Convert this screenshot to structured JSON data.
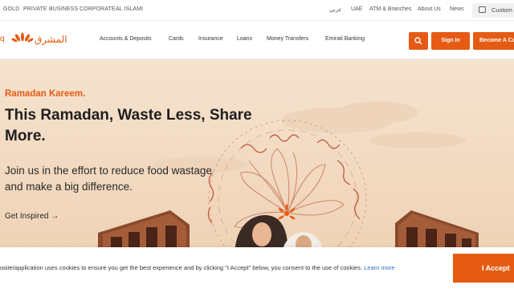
{
  "segments": [
    "GOLD",
    "PRIVATE",
    "BUSINESS",
    "CORPORATE",
    "AL ISLAMI"
  ],
  "utility_links": [
    "عربي",
    "UAE",
    "ATM & Branches",
    "About Us",
    "News"
  ],
  "customer_button": "Custom",
  "logo": {
    "arabic_text": "المشرق",
    "edge_glyph": "q"
  },
  "nav_items": [
    "Accounts & Deposits",
    "Cards",
    "Insurance",
    "Loans",
    "Money Transfers",
    "Emirati Banking"
  ],
  "buttons": {
    "sign_in": "Sign In",
    "become_customer": "Become A Cu"
  },
  "hero": {
    "eyebrow": "Ramadan Kareem.",
    "headline": "This Ramadan, Waste Less, Share More.",
    "subtext": "Join us in the effort to reduce food wastage and make a big difference.",
    "cta": "Get Inspired",
    "cta_arrow": "→"
  },
  "cookie": {
    "text": "osite/application uses cookies to ensure you get the best experience and by clicking \"I Accept\" below, you consent to the use of cookies.",
    "link": "Learn more",
    "accept": "I Accept"
  },
  "colors": {
    "accent": "#e55b13",
    "hero_bg": "#f5e3cf",
    "link": "#2a6ebb"
  },
  "icons": [
    "search-icon",
    "customer-service-icon",
    "logo-sunburst-icon",
    "arrow-right-icon"
  ]
}
